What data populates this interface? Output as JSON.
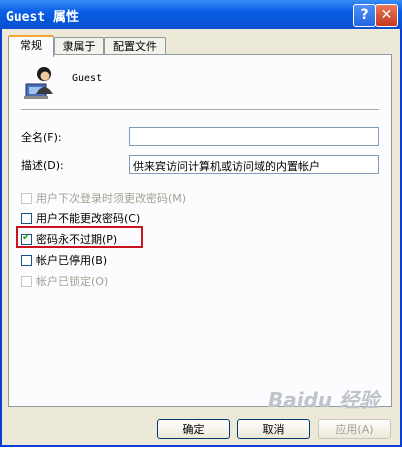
{
  "window": {
    "title": "Guest 属性",
    "help_glyph": "?",
    "close_glyph": "✕"
  },
  "tabs": [
    {
      "label": "常规",
      "active": true
    },
    {
      "label": "隶属于",
      "active": false
    },
    {
      "label": "配置文件",
      "active": false
    }
  ],
  "user": {
    "name": "Guest"
  },
  "fields": {
    "fullname": {
      "label": "全名(F):",
      "value": ""
    },
    "description": {
      "label": "描述(D):",
      "value": "供来宾访问计算机或访问域的内置帐户"
    }
  },
  "checkboxes": [
    {
      "label": "用户下次登录时须更改密码(M)",
      "checked": false,
      "disabled": true
    },
    {
      "label": "用户不能更改密码(C)",
      "checked": false,
      "disabled": false
    },
    {
      "label": "密码永不过期(P)",
      "checked": true,
      "disabled": false
    },
    {
      "label": "帐户已停用(B)",
      "checked": false,
      "disabled": false
    },
    {
      "label": "帐户已锁定(O)",
      "checked": false,
      "disabled": true
    }
  ],
  "buttons": {
    "ok": "确定",
    "cancel": "取消",
    "apply": "应用(A)"
  },
  "watermark": "Baidu 经验",
  "colors": {
    "title_bar": "#0a5ee6",
    "highlight_box": "#c8141e",
    "checkmark": "#21a121"
  }
}
